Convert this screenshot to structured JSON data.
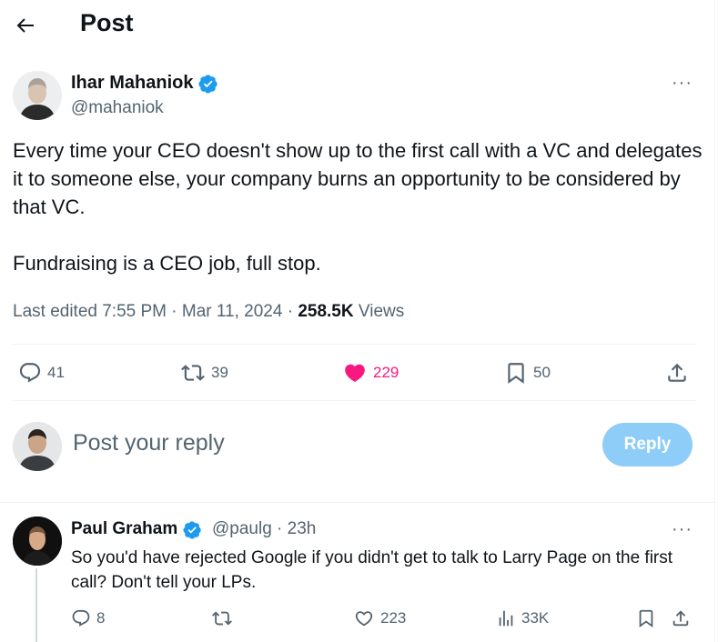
{
  "header": {
    "title": "Post",
    "back_icon": "arrow-left-icon"
  },
  "post": {
    "author_name": "Ihar Mahaniok",
    "author_handle": "@mahaniok",
    "verified": true,
    "more_icon": "···",
    "paragraphs": [
      "Every time your CEO doesn't show up to the first call with a VC and delegates it to someone else, your company burns an opportunity to be considered by that VC.",
      "Fundraising is a CEO job, full stop."
    ],
    "meta": {
      "edited": "Last edited 7:55 PM · Mar 11, 2024 · ",
      "views_count": "258.5K",
      "views_label": " Views"
    },
    "stats": {
      "replies": "41",
      "reposts": "39",
      "likes": "229",
      "bookmarks": "50"
    }
  },
  "composer": {
    "placeholder": "Post your reply",
    "button_label": "Reply"
  },
  "comment": {
    "author_name": "Paul Graham",
    "author_handle": "@paulg · 23h",
    "verified": true,
    "more_icon": "···",
    "text": "So you'd have rejected Google if you didn't get to talk to Larry Page on the first call? Don't tell your LPs.",
    "stats": {
      "replies": "8",
      "likes": "223",
      "views": "33K"
    }
  },
  "colors": {
    "accent": "#1d9bf0",
    "like_active": "#f91880",
    "muted": "#536471",
    "reply_button": "#8ecdf8"
  }
}
